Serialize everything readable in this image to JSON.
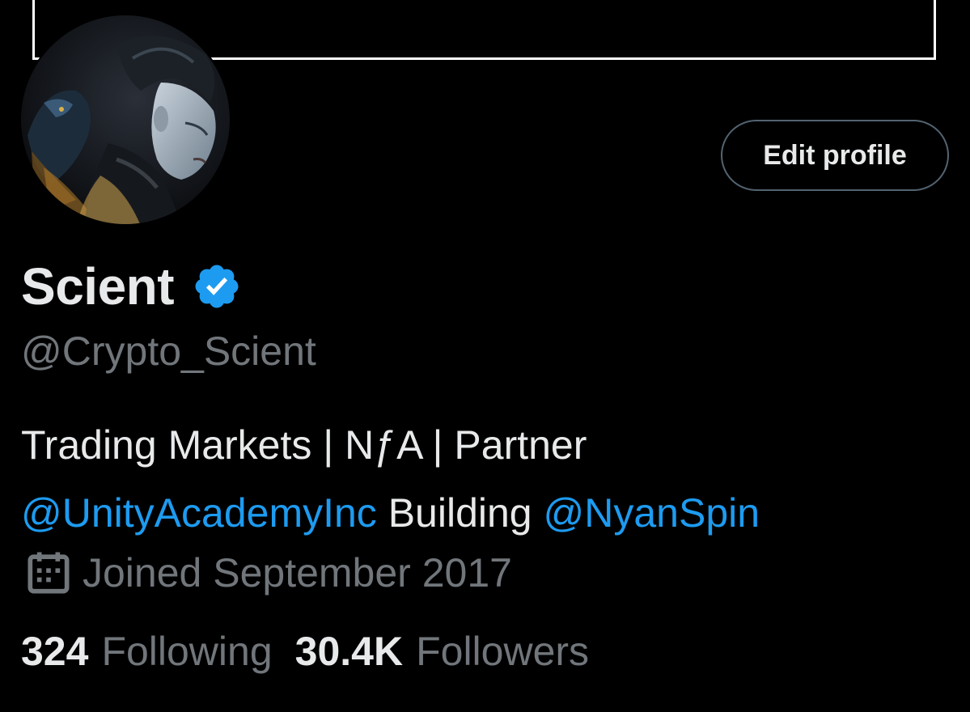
{
  "profile": {
    "display_name": "Scient",
    "handle": "@Crypto_Scient",
    "verified": true,
    "edit_button_label": "Edit profile",
    "bio": {
      "line1": "Trading Markets | NƒA | Partner",
      "mention1": "@UnityAcademyInc",
      "middle_text": " Building ",
      "mention2": "@NyanSpin"
    },
    "joined": "Joined September 2017",
    "following_count": "324",
    "following_label": "Following",
    "followers_count": "30.4K",
    "followers_label": "Followers"
  },
  "icons": {
    "verified_badge": "verified-badge-icon",
    "calendar": "calendar-icon"
  },
  "colors": {
    "background": "#000000",
    "text_primary": "#e7e9ea",
    "text_secondary": "#71767b",
    "link": "#1d9bf0",
    "button_border": "#536471",
    "verified_blue": "#1d9bf0"
  }
}
